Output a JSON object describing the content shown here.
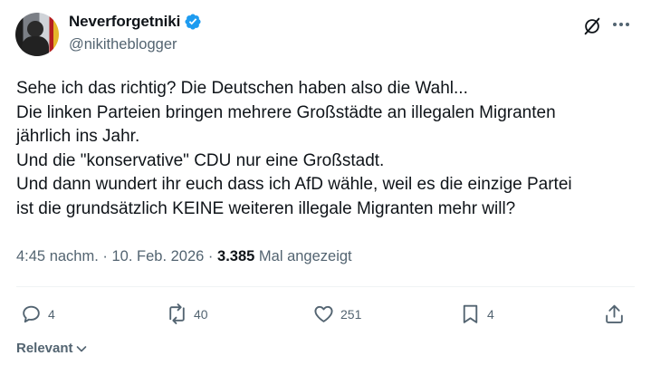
{
  "author": {
    "display_name": "Neverforgetniki",
    "handle": "@nikitheblogger",
    "verified": true
  },
  "tweet": {
    "lines": [
      "Sehe ich das richtig? Die Deutschen haben also die Wahl...",
      "Die linken Parteien bringen mehrere Großstädte an illegalen Migranten",
      "jährlich ins Jahr.",
      "Und die \"konservative\" CDU nur eine Großstadt.",
      "Und dann wundert ihr euch dass ich AfD wähle, weil es die einzige Partei",
      "ist die grundsätzlich KEINE weiteren illegale Migranten mehr will?"
    ],
    "time": "4:45 nachm.",
    "date": "10. Feb. 2026",
    "views": "3.385",
    "views_label": "Mal angezeigt"
  },
  "actions": {
    "replies": "4",
    "reposts": "40",
    "likes": "251",
    "bookmarks": "4"
  },
  "sort": {
    "label": "Relevant"
  },
  "colors": {
    "verified": "#1d9bf0",
    "secondary_text": "#536471"
  },
  "icons": [
    "verified-badge-icon",
    "grok-icon",
    "more-icon",
    "reply-icon",
    "repost-icon",
    "like-icon",
    "bookmark-icon",
    "share-icon",
    "chevron-down-icon"
  ]
}
